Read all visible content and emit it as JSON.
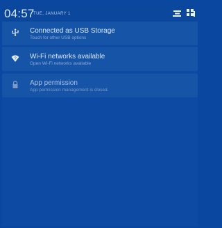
{
  "status_bar": {
    "time": "04:57",
    "date": "TUE, JANUARY 1",
    "icons": [
      "sort-icon",
      "notification-grid-icon"
    ]
  },
  "notifications": [
    {
      "icon": "usb-icon",
      "title": "Connected as USB Storage",
      "subtitle": "Touch for other USB options"
    },
    {
      "icon": "wifi-question-icon",
      "title": "Wi-Fi networks available",
      "subtitle": "Open Wi-Fi networks available"
    },
    {
      "icon": "lock-icon",
      "title": "App permission",
      "subtitle": "App permission management is closed."
    }
  ],
  "colors": {
    "background": "#0a47a0",
    "panel": "#1654a8",
    "text": "#d9e6ff",
    "subtext": "#8ea8d2"
  }
}
